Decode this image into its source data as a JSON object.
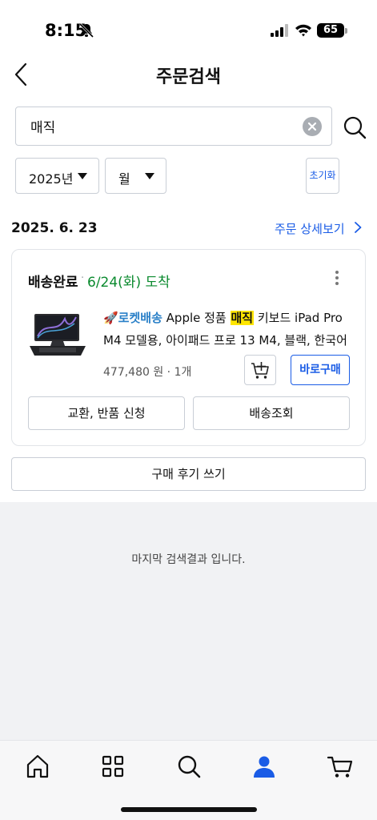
{
  "status_bar": {
    "time": "8:15",
    "battery": "65"
  },
  "header": {
    "title": "주문검색"
  },
  "search": {
    "value": "매직",
    "placeholder": ""
  },
  "filters": {
    "year": "2025년",
    "month": "월",
    "reset_label": "초기화"
  },
  "order": {
    "date": "2025. 6. 23",
    "detail_link": "주문 상세보기",
    "status": "배송완료",
    "separator": "·",
    "arrival": "6/24(화) 도착",
    "product": {
      "rocket_label": "🚀로켓배송",
      "title_pre": " Apple 정품 ",
      "title_highlight": "매직",
      "title_post": " 키보드 iPad Pro",
      "title_line2": "M4 모델용, 아이패드 프로 13 M4, 블랙, 한국어",
      "price_qty": "477,480 원 · 1개"
    },
    "buy_now_label": "바로구매",
    "exchange_label": "교환, 반품 신청",
    "tracking_label": "배송조회"
  },
  "review_button": "구매 후기 쓰기",
  "end_message": "마지막 검색결과 입니다.",
  "colors": {
    "accent": "#1a5ce6",
    "arrival": "#0a8a2e",
    "highlight": "#ffe600",
    "rocket": "#2a80c8"
  },
  "bottom_nav": [
    {
      "icon": "home-icon"
    },
    {
      "icon": "category-grid-icon"
    },
    {
      "icon": "search-icon"
    },
    {
      "icon": "my-account-icon",
      "active": true
    },
    {
      "icon": "cart-icon"
    }
  ]
}
